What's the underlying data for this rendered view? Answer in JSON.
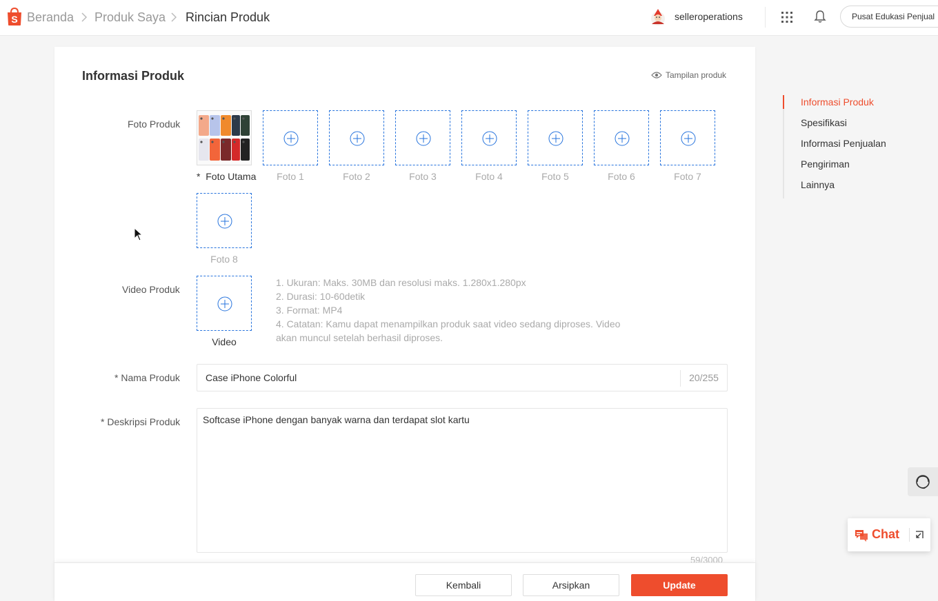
{
  "header": {
    "breadcrumb": [
      {
        "label": "Beranda"
      },
      {
        "label": "Produk Saya"
      },
      {
        "label": "Rincian Produk"
      }
    ],
    "username": "selleroperations",
    "education_button": "Pusat Edukasi Penjual"
  },
  "form": {
    "title": "Informasi Produk",
    "preview_link": "Tampilan produk",
    "photo": {
      "label": "Foto Produk",
      "main_label": "Foto Utama",
      "required_mark": "*",
      "slots": [
        "Foto 1",
        "Foto 2",
        "Foto 3",
        "Foto 4",
        "Foto 5",
        "Foto 6",
        "Foto 7",
        "Foto 8"
      ]
    },
    "video": {
      "label": "Video Produk",
      "slot_label": "Video",
      "info": [
        "1. Ukuran: Maks. 30MB dan resolusi maks. 1.280x1.280px",
        "2. Durasi: 10-60detik",
        "3. Format: MP4",
        "4. Catatan: Kamu dapat menampilkan produk saat video sedang diproses. Video akan muncul setelah berhasil diproses."
      ]
    },
    "name": {
      "label": "* Nama Produk",
      "value": "Case iPhone Colorful",
      "counter": "20/255"
    },
    "description": {
      "label": "* Deskripsi Produk",
      "value": "Softcase iPhone dengan banyak warna dan terdapat slot kartu",
      "counter": "59/3000"
    }
  },
  "footer": {
    "back": "Kembali",
    "archive": "Arsipkan",
    "update": "Update"
  },
  "side_nav": {
    "items": [
      "Informasi Produk",
      "Spesifikasi",
      "Informasi Penjualan",
      "Pengiriman",
      "Lainnya"
    ],
    "active": "Informasi Produk"
  },
  "chat": {
    "label": "Chat"
  },
  "colors": {
    "brand": "#ee4d2d",
    "upload_border": "#2673dd"
  },
  "icons": {
    "logo": "shopee-bag-icon",
    "apps": "apps-grid-icon",
    "notification": "bell-icon",
    "preview": "eye-icon",
    "upload": "plus-circle-icon",
    "support": "headset-icon",
    "chat": "chat-bubble-icon",
    "expand": "expand-icon"
  }
}
